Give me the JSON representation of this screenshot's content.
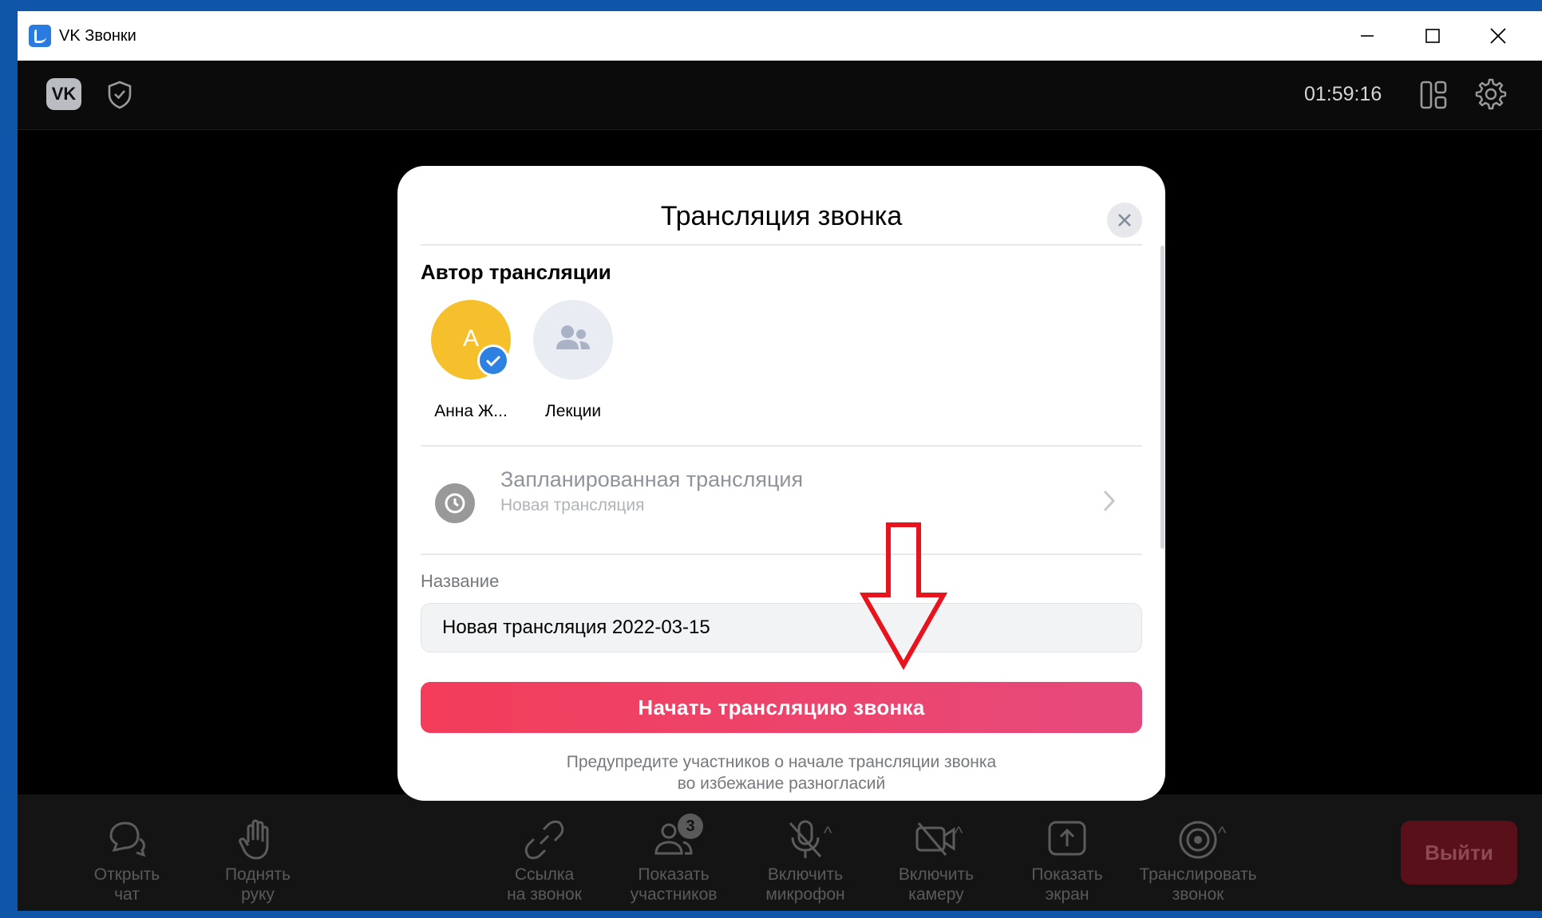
{
  "window": {
    "title": "VK Звонки",
    "controls": [
      "minimize",
      "maximize",
      "close"
    ]
  },
  "topbar": {
    "logo": "VK",
    "timer": "01:59:16",
    "icons": [
      "shield-icon",
      "layout-icon",
      "gear-icon"
    ]
  },
  "modal": {
    "title": "Трансляция звонка",
    "author_section_title": "Автор трансляции",
    "authors": [
      {
        "initial": "А",
        "name": "Анна Ж...",
        "selected": true
      },
      {
        "initial": "",
        "name": "Лекции",
        "selected": false
      }
    ],
    "scheduled": {
      "title": "Запланированная трансляция",
      "subtitle": "Новая трансляция"
    },
    "name_label": "Название",
    "name_value": "Новая трансляция 2022-03-15",
    "start_button": "Начать трансляцию звонка",
    "warning_line1": "Предупредите участников о начале трансляции звонка",
    "warning_line2": "во избежание разногласий"
  },
  "toolbar": {
    "open_chat": "Открыть\nчат",
    "raise_hand": "Поднять\nруку",
    "call_link": "Ссылка\nна звонок",
    "show_participants": "Показать\nучастников",
    "participants_count": "3",
    "enable_mic": "Включить\nмикрофон",
    "enable_camera": "Включить\nкамеру",
    "share_screen": "Показать\nэкран",
    "broadcast_call": "Транслировать\nзвонок",
    "exit": "Выйти"
  },
  "colors": {
    "accent_red": "#f33d5a",
    "avatar_yellow": "#f6c02c",
    "check_blue": "#2d81e0",
    "annotation_arrow": "#e8141d"
  }
}
